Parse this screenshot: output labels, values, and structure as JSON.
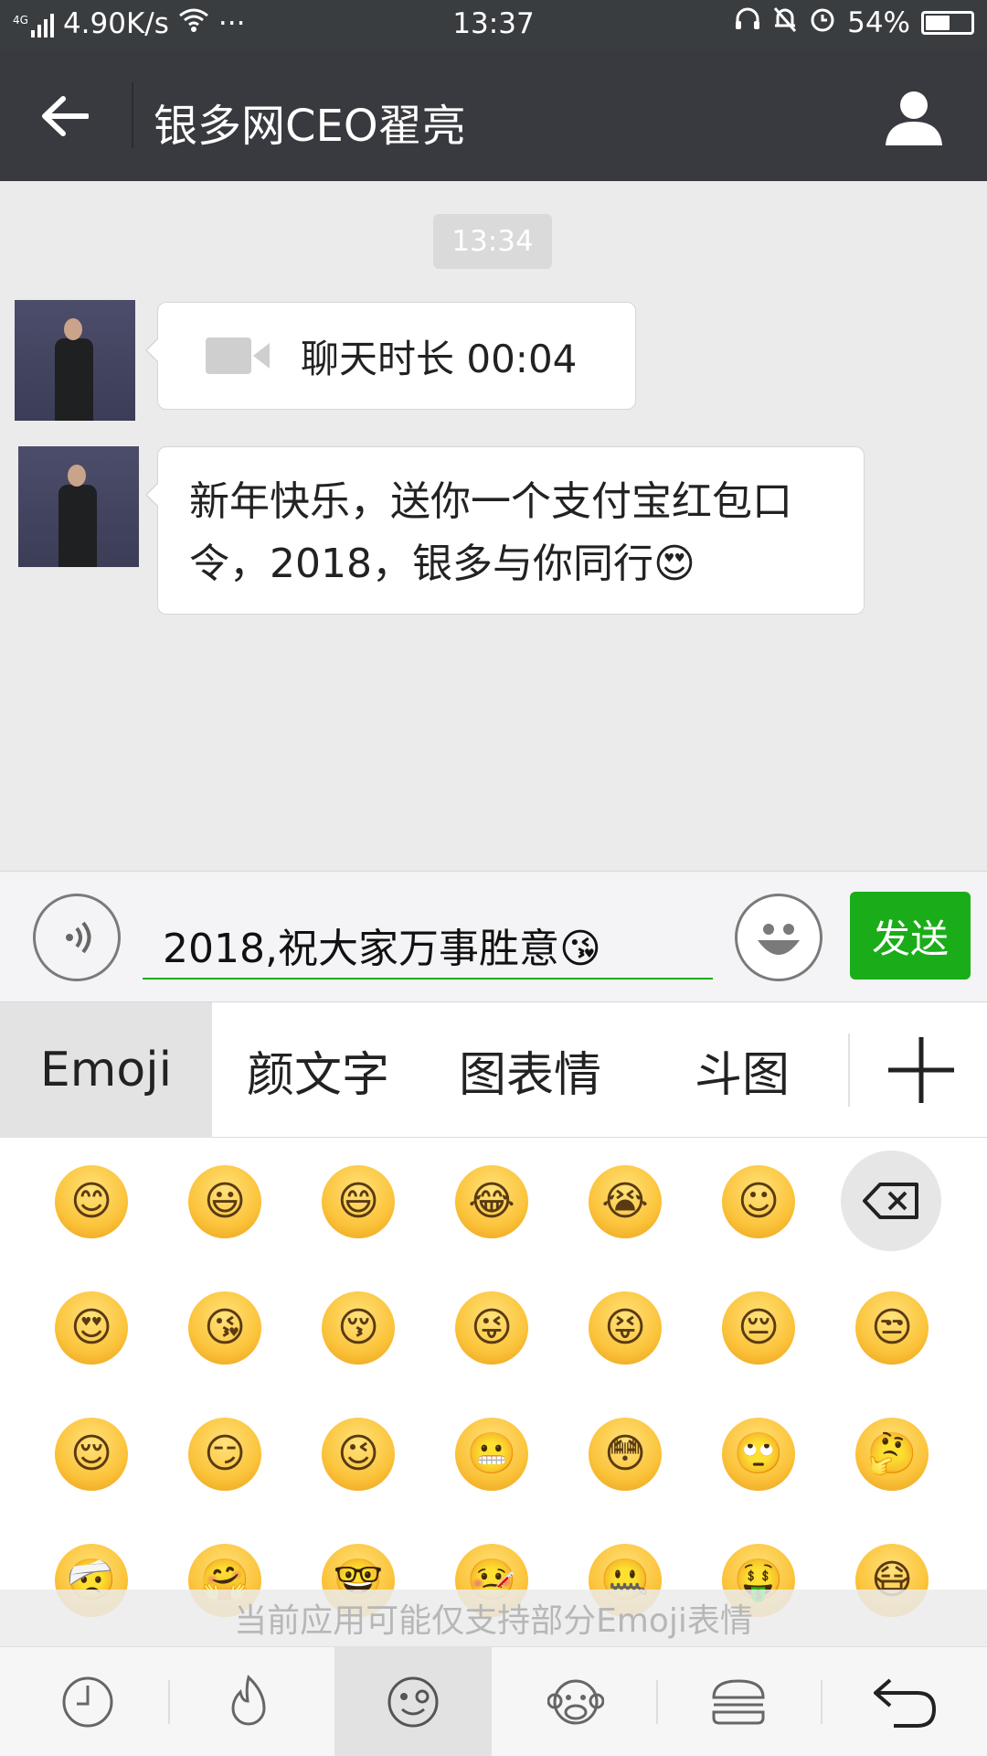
{
  "status_bar": {
    "network": "4G",
    "speed": "4.90K/s",
    "more": "···",
    "time": "13:37",
    "battery_text": "54%",
    "battery_level": 0.54
  },
  "header": {
    "back_icon": "arrow-left-icon",
    "title": "银多网CEO翟亮",
    "profile_icon": "person-icon"
  },
  "chat": {
    "timestamp": "13:34",
    "messages": [
      {
        "type": "video-call",
        "icon": "video-camera-icon",
        "text": "聊天时长 00:04"
      },
      {
        "type": "text",
        "text": "新年快乐，送你一个支付宝红包口令，2018，银多与你同行😍"
      }
    ]
  },
  "input_bar": {
    "voice_icon": "voice-icon",
    "input_value": "2018,祝大家万事胜意😘",
    "emoji_icon": "smiley-icon",
    "send_label": "发送"
  },
  "keyboard_tabs": [
    "Emoji",
    "颜文字",
    "图表情",
    "斗图"
  ],
  "keyboard_active_tab": "Emoji",
  "emoji_rows": [
    [
      "😊",
      "😃",
      "😄",
      "😂",
      "😭",
      "☺"
    ],
    [
      "😍",
      "😘",
      "😚",
      "😜",
      "😝",
      "😔",
      "😒"
    ],
    [
      "😌",
      "😏",
      "😉",
      "😬",
      "😳",
      "🙄",
      "🤔"
    ],
    [
      "🤕",
      "🤗",
      "🤓",
      "🤒",
      "🤐",
      "🤑",
      "😷"
    ]
  ],
  "emoji_notice": "当前应用可能仅支持部分Emoji表情",
  "bottom_bar": [
    "clock-icon",
    "fire-icon",
    "emoji-face-icon",
    "monkey-icon",
    "burger-icon",
    "return-icon"
  ],
  "colors": {
    "accent_green": "#1aad19",
    "header_bg": "#393a3f",
    "status_bg": "#3a3d40"
  }
}
